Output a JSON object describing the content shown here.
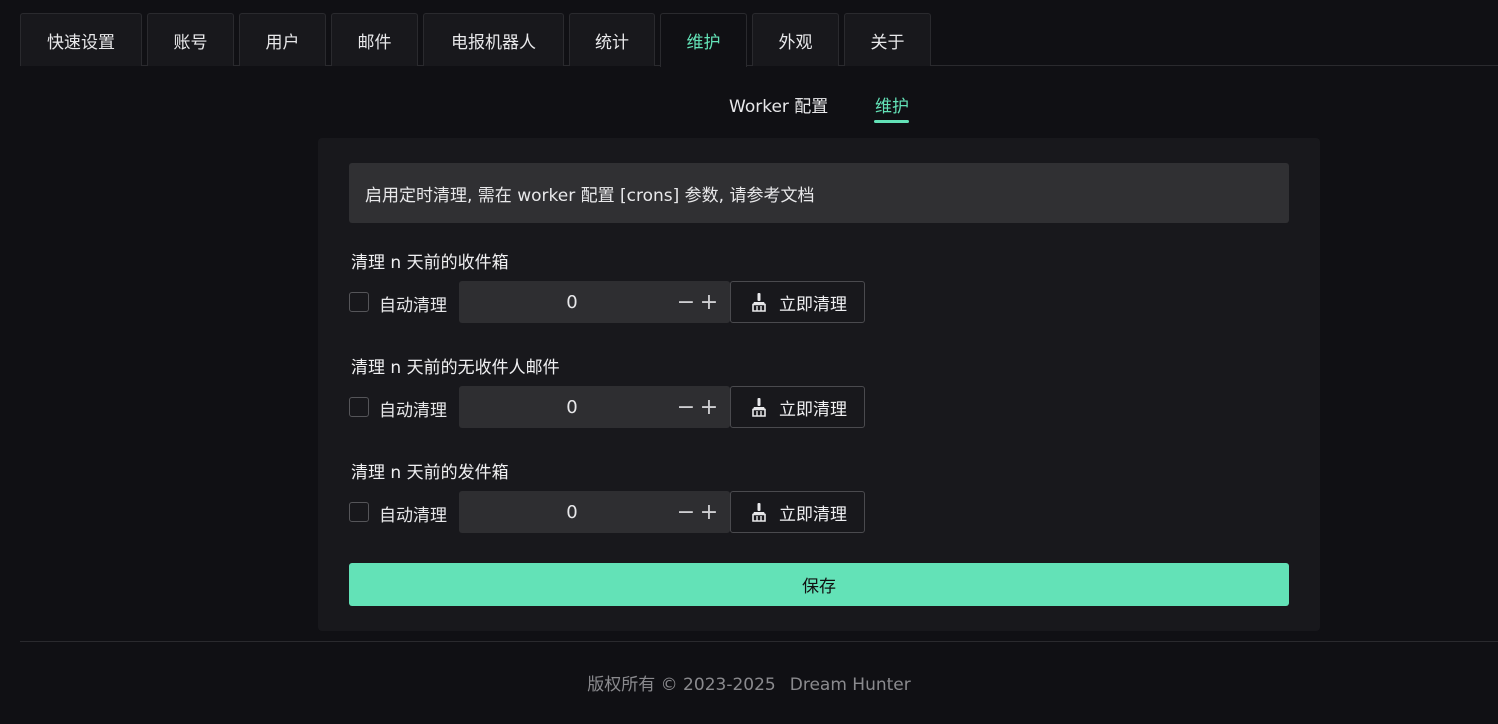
{
  "top_tabs": [
    {
      "label": "快速设置"
    },
    {
      "label": "账号"
    },
    {
      "label": "用户"
    },
    {
      "label": "邮件"
    },
    {
      "label": "电报机器人"
    },
    {
      "label": "统计"
    },
    {
      "label": "维护",
      "active": true
    },
    {
      "label": "外观"
    },
    {
      "label": "关于"
    }
  ],
  "sub_tabs": [
    {
      "label": "Worker 配置"
    },
    {
      "label": "维护",
      "active": true
    }
  ],
  "alert": "启用定时清理, 需在 worker 配置 [crons] 参数, 请参考文档",
  "sections": [
    {
      "title": "清理 n 天前的收件箱",
      "auto_clean_label": "自动清理",
      "auto_clean_checked": false,
      "days": "0",
      "clean_button": "立即清理"
    },
    {
      "title": "清理 n 天前的无收件人邮件",
      "auto_clean_label": "自动清理",
      "auto_clean_checked": false,
      "days": "0",
      "clean_button": "立即清理"
    },
    {
      "title": "清理 n 天前的发件箱",
      "auto_clean_label": "自动清理",
      "auto_clean_checked": false,
      "days": "0",
      "clean_button": "立即清理"
    }
  ],
  "stepper": {
    "minus": "−",
    "plus": "+"
  },
  "save_button": "保存",
  "footer": {
    "copyright": "版权所有 © 2023-2025",
    "author": "Dream Hunter"
  },
  "colors": {
    "accent": "#63e2b7",
    "background": "#101014",
    "card": "#18181c"
  },
  "icons": {
    "clean_button": "broom-icon"
  }
}
